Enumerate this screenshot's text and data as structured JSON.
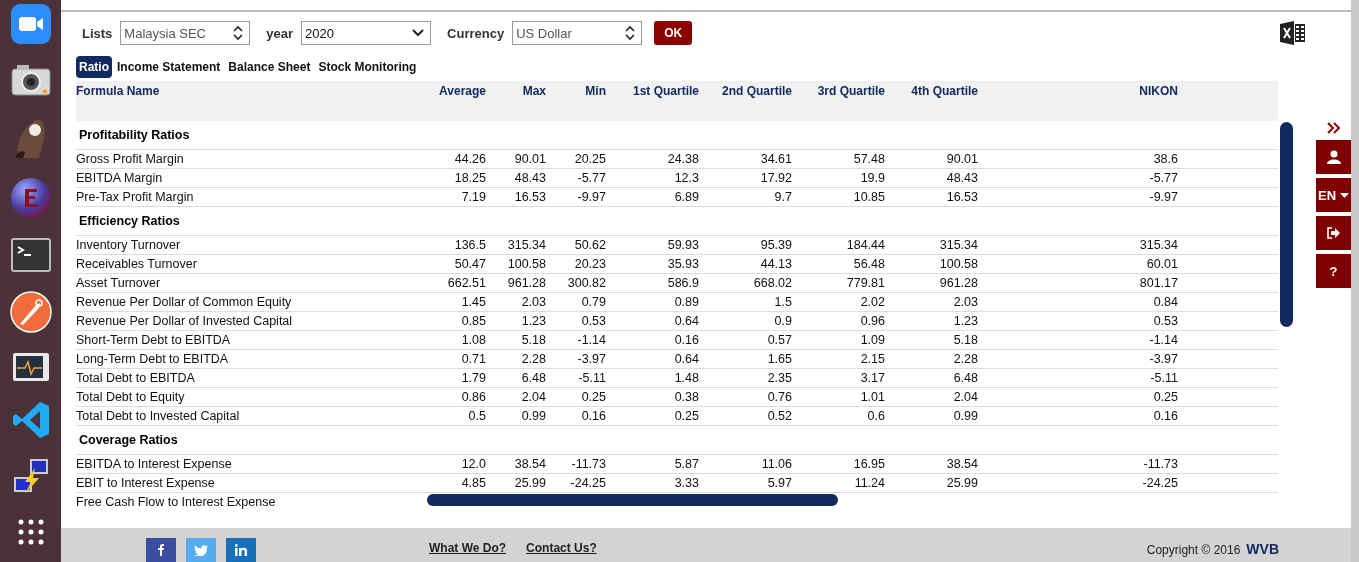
{
  "filters": [
    {
      "label": "Lists",
      "value": "Malaysia SEC",
      "kind": "spinner"
    },
    {
      "label": "year",
      "value": "2020",
      "kind": "dropdown"
    },
    {
      "label": "Currency",
      "value": "US Dollar",
      "kind": "spinner"
    }
  ],
  "ok_button": "OK",
  "tabs": [
    {
      "label": "Ratio",
      "selected": true
    },
    {
      "label": "Income Statement",
      "selected": false
    },
    {
      "label": "Balance Sheet",
      "selected": false
    },
    {
      "label": "Stock Monitoring",
      "selected": false
    }
  ],
  "table": {
    "columns": [
      "Formula Name",
      "Average",
      "Max",
      "Min",
      "1st Quartile",
      "2nd Quartile",
      "3rd Quartile",
      "4th Quartile",
      "NIKON"
    ],
    "sections": [
      {
        "title": "Profitability Ratios",
        "rows": [
          {
            "name": "Gross Profit Margin",
            "values": [
              "44.26",
              "90.01",
              "20.25",
              "24.38",
              "34.61",
              "57.48",
              "90.01",
              "38.6"
            ]
          },
          {
            "name": "EBITDA Margin",
            "values": [
              "18.25",
              "48.43",
              "-5.77",
              "12.3",
              "17.92",
              "19.9",
              "48.43",
              "-5.77"
            ]
          },
          {
            "name": "Pre-Tax Profit Margin",
            "values": [
              "7.19",
              "16.53",
              "-9.97",
              "6.89",
              "9.7",
              "10.85",
              "16.53",
              "-9.97"
            ]
          }
        ]
      },
      {
        "title": "Efficiency Ratios",
        "rows": [
          {
            "name": "Inventory Turnover",
            "values": [
              "136.5",
              "315.34",
              "50.62",
              "59.93",
              "95.39",
              "184.44",
              "315.34",
              "315.34"
            ]
          },
          {
            "name": "Receivables Turnover",
            "values": [
              "50.47",
              "100.58",
              "20.23",
              "35.93",
              "44.13",
              "56.48",
              "100.58",
              "60.01"
            ]
          },
          {
            "name": "Asset Turnover",
            "values": [
              "662.51",
              "961.28",
              "300.82",
              "586.9",
              "668.02",
              "779.81",
              "961.28",
              "801.17"
            ]
          },
          {
            "name": "Revenue Per Dollar of Common Equity",
            "values": [
              "1.45",
              "2.03",
              "0.79",
              "0.89",
              "1.5",
              "2.02",
              "2.03",
              "0.84"
            ]
          },
          {
            "name": "Revenue Per Dollar of Invested Capital",
            "values": [
              "0.85",
              "1.23",
              "0.53",
              "0.64",
              "0.9",
              "0.96",
              "1.23",
              "0.53"
            ]
          },
          {
            "name": "Short-Term Debt to EBITDA",
            "values": [
              "1.08",
              "5.18",
              "-1.14",
              "0.16",
              "0.57",
              "1.09",
              "5.18",
              "-1.14"
            ]
          },
          {
            "name": "Long-Term Debt to EBITDA",
            "values": [
              "0.71",
              "2.28",
              "-3.97",
              "0.64",
              "1.65",
              "2.15",
              "2.28",
              "-3.97"
            ]
          },
          {
            "name": "Total Debt to EBITDA",
            "values": [
              "1.79",
              "6.48",
              "-5.11",
              "1.48",
              "2.35",
              "3.17",
              "6.48",
              "-5.11"
            ]
          },
          {
            "name": "Total Debt to Equity",
            "values": [
              "0.86",
              "2.04",
              "0.25",
              "0.38",
              "0.76",
              "1.01",
              "2.04",
              "0.25"
            ]
          },
          {
            "name": "Total Debt to Invested Capital",
            "values": [
              "0.5",
              "0.99",
              "0.16",
              "0.25",
              "0.52",
              "0.6",
              "0.99",
              "0.16"
            ]
          }
        ]
      },
      {
        "title": "Coverage Ratios",
        "rows": [
          {
            "name": "EBITDA to Interest Expense",
            "values": [
              "12.0",
              "38.54",
              "-11.73",
              "5.87",
              "11.06",
              "16.95",
              "38.54",
              "-11.73"
            ]
          },
          {
            "name": "EBIT to Interest Expense",
            "values": [
              "4.85",
              "25.99",
              "-24.25",
              "3.33",
              "5.97",
              "11.24",
              "25.99",
              "-24.25"
            ]
          },
          {
            "name": "Free Cash Flow to Interest Expense"
          }
        ]
      }
    ]
  },
  "side_buttons": [
    {
      "kind": "user"
    },
    {
      "kind": "language",
      "label": "EN"
    },
    {
      "kind": "logout"
    },
    {
      "kind": "help",
      "label": "?"
    }
  ],
  "footer": {
    "links": [
      "What We Do?",
      "Contact Us?"
    ],
    "copyright": "Copyright © 2016",
    "brand": "WVB"
  }
}
